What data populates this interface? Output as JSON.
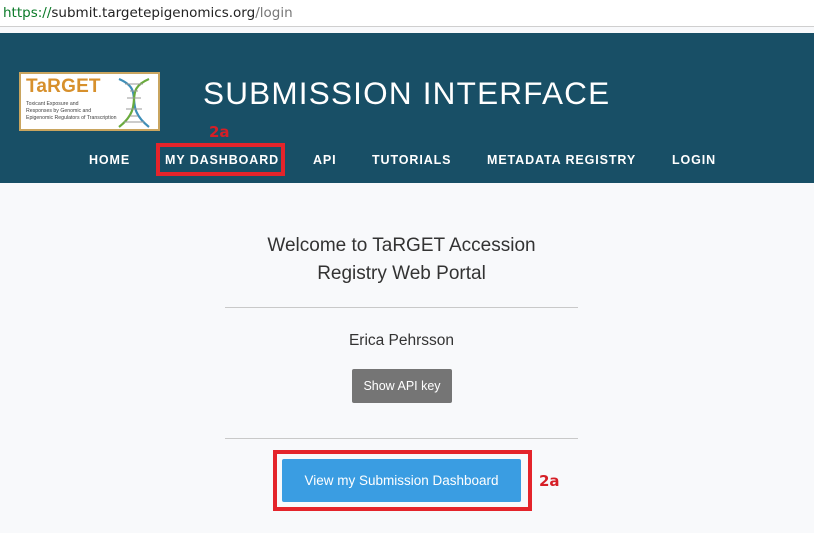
{
  "browser": {
    "url_scheme": "https://",
    "url_host": "submit.targetepigenomics.org",
    "url_path": "/login"
  },
  "header": {
    "logo": {
      "title": "TaRGET",
      "lines": [
        "Toxicant Exposure and",
        "Responses by Genomic and",
        "Epigenomic Regulators of Transcription"
      ]
    },
    "title": "SUBMISSION INTERFACE",
    "nav": [
      {
        "label": "HOME"
      },
      {
        "label": "MY DASHBOARD"
      },
      {
        "label": "API"
      },
      {
        "label": "TUTORIALS"
      },
      {
        "label": "METADATA REGISTRY"
      },
      {
        "label": "LOGIN"
      }
    ],
    "background_color": "#184f66"
  },
  "annotations": {
    "nav_label": "2a",
    "button_label": "2a",
    "color": "#e4242b"
  },
  "main": {
    "welcome_line1": "Welcome to TaRGET Accession",
    "welcome_line2": "Registry Web Portal",
    "user_name": "Erica Pehrsson",
    "show_api_key_label": "Show API key",
    "dashboard_button_label": "View my Submission Dashboard",
    "dashboard_button_color": "#3a9de2"
  }
}
